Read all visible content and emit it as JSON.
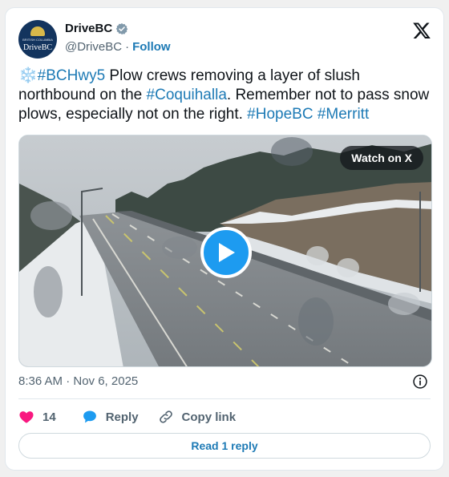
{
  "author": {
    "display_name": "DriveBC",
    "handle": "@DriveBC",
    "follow_label": "Follow",
    "separator": "·",
    "avatar_small_text": "BRITISH COLUMBIA",
    "avatar_mark": "DriveBC",
    "verified_color": "#829aab"
  },
  "tweet": {
    "emoji": "❄️",
    "hashtag_hwy": "#BCHwy5",
    "text_1": " Plow crews removing a layer of slush northbound on the ",
    "hashtag_coq": "#Coquihalla",
    "text_2": ". Remember not to pass snow plows, especially not on the right. ",
    "hashtag_hope": "#HopeBC",
    "space": " ",
    "hashtag_merritt": "#Merritt"
  },
  "media": {
    "watch_label": "Watch on X",
    "play_icon": "play-icon"
  },
  "meta": {
    "timestamp": "8:36 AM · Nov 6, 2025"
  },
  "actions": {
    "like_count": "14",
    "reply_label": "Reply",
    "copy_link_label": "Copy link",
    "read_reply_label": "Read 1 reply"
  },
  "colors": {
    "link": "#1d7ab5",
    "like_heart": "#f91880",
    "reply_bubble": "#1d9bf0",
    "play_button": "#1d9bf0"
  }
}
